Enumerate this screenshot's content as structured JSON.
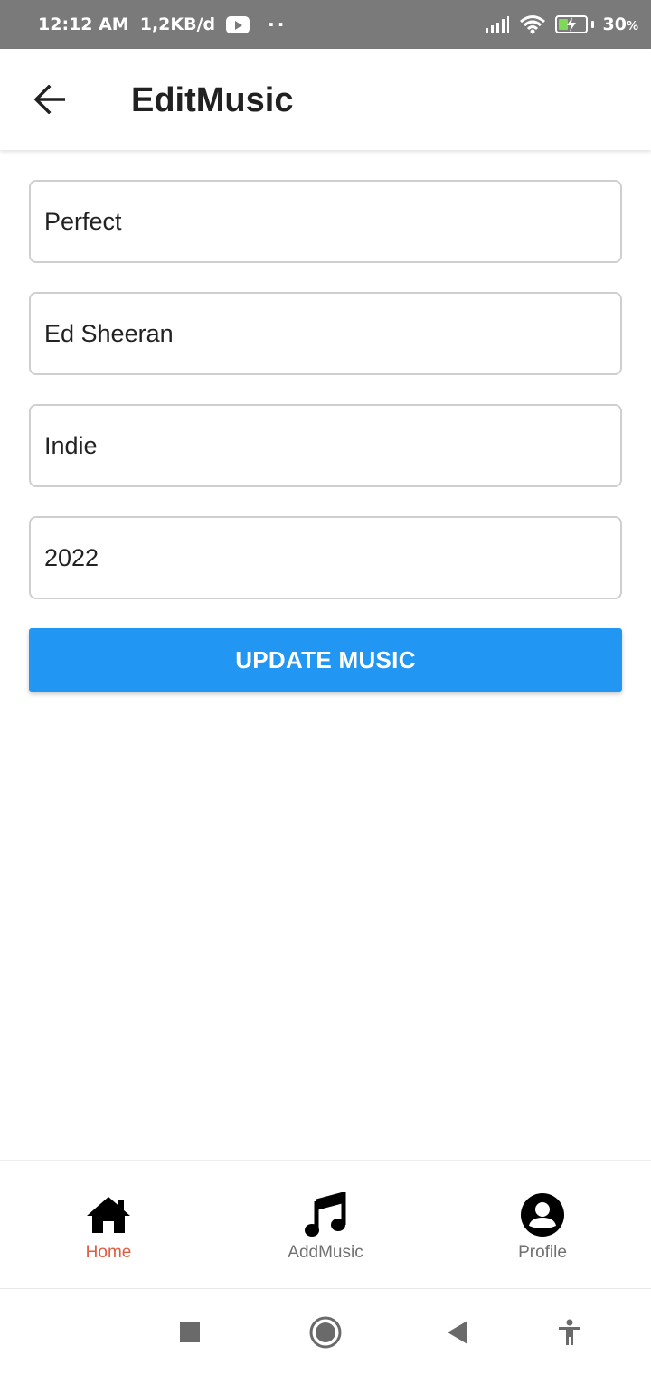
{
  "status_bar": {
    "time": "12:12 AM",
    "data_rate": "1,2KB/d",
    "battery_level": "30",
    "battery_unit": "%",
    "icons": [
      "youtube-icon",
      "signal-icon",
      "wifi-icon",
      "battery-charging-icon"
    ]
  },
  "app_bar": {
    "title": "EditMusic",
    "back_icon": "arrow-left-icon"
  },
  "form": {
    "title_value": "Perfect",
    "artist_value": "Ed Sheeran",
    "genre_value": "Indie",
    "year_value": "2022",
    "submit_label": "UPDATE MUSIC"
  },
  "bottom_nav": {
    "items": [
      {
        "label": "Home",
        "icon": "home-icon",
        "active": true
      },
      {
        "label": "AddMusic",
        "icon": "music-note-icon",
        "active": false
      },
      {
        "label": "Profile",
        "icon": "account-circle-icon",
        "active": false
      }
    ]
  },
  "colors": {
    "primary_button": "#2196f3",
    "active_nav": "#e05d40",
    "inactive_nav": "#707070",
    "status_bar_bg": "#7a7a7a"
  }
}
